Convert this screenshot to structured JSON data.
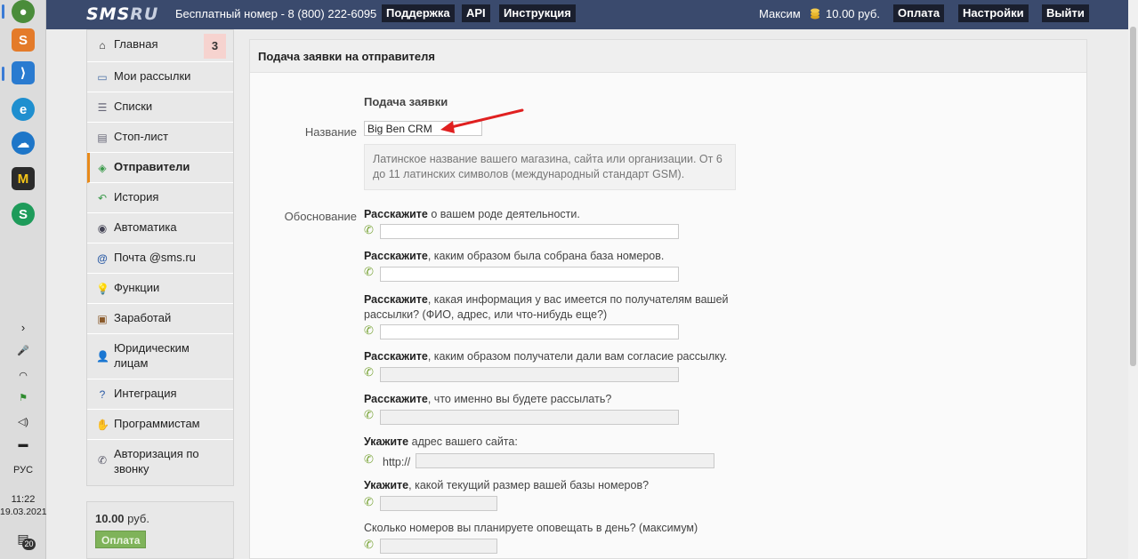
{
  "taskbar": {
    "apps": [
      {
        "name": "chrome-icon",
        "color": "#4a8c3a"
      },
      {
        "name": "sublime-icon",
        "color": "#e47b2a"
      },
      {
        "name": "vscode-icon",
        "color": "#2a7bd0"
      },
      {
        "name": "edge-icon",
        "color": "#1f8fcf"
      },
      {
        "name": "cloud-app-icon",
        "color": "#1e76c8"
      },
      {
        "name": "m-app-icon",
        "color": "#2b2b2b"
      },
      {
        "name": "s-app-icon",
        "color": "#1e9b5a"
      }
    ],
    "lang": "РУС",
    "time": "11:22",
    "date": "19.03.2021",
    "notifications": "20"
  },
  "header": {
    "logo_main": "SMS",
    "logo_suffix": "RU",
    "free_number": "Бесплатный номер - 8 (800) 222-6095",
    "support": "Поддержка",
    "api": "API",
    "instructions": "Инструкция",
    "user": "Максим",
    "balance": "10.00 руб.",
    "pay": "Оплата",
    "settings": "Настройки",
    "logout": "Выйти"
  },
  "sidebar": {
    "items": [
      {
        "label": "Главная",
        "icon": "home-icon",
        "badge": "3"
      },
      {
        "label": "Мои рассылки",
        "icon": "mailings-icon"
      },
      {
        "label": "Списки",
        "icon": "lists-icon"
      },
      {
        "label": "Стоп-лист",
        "icon": "stoplist-icon"
      },
      {
        "label": "Отправители",
        "icon": "tag-icon",
        "active": true
      },
      {
        "label": "История",
        "icon": "history-icon"
      },
      {
        "label": "Автоматика",
        "icon": "automation-icon"
      },
      {
        "label": "Почта @sms.ru",
        "icon": "at-icon"
      },
      {
        "label": "Функции",
        "icon": "bulb-icon"
      },
      {
        "label": "Заработай",
        "icon": "earn-icon"
      },
      {
        "label": "Юридическим лицам",
        "icon": "person-icon"
      },
      {
        "label": "Интеграция",
        "icon": "help-icon"
      },
      {
        "label": "Программистам",
        "icon": "hand-icon"
      },
      {
        "label": "Авторизация по звонку",
        "icon": "phone-icon"
      }
    ],
    "balance_amount": "10.00",
    "balance_unit": "руб.",
    "pay_button": "Оплата"
  },
  "form": {
    "panel_title": "Подача заявки на отправителя",
    "section_title": "Подача заявки",
    "name_label": "Название",
    "name_value": "Big Ben CRM",
    "hint": "Латинское название вашего магазина, сайта или организации. От 6 до 11 латинских символов (международный стандарт GSM).",
    "reason_label": "Обоснование",
    "questions": [
      {
        "bold": "Расскажите",
        "text": " о вашем роде деятельности."
      },
      {
        "bold": "Расскажите",
        "text": ", каким образом была собрана база номеров."
      },
      {
        "bold": "Расскажите",
        "text": ", какая информация у вас имеется по получателям вашей рассылки? (ФИО, адрес, или что-нибудь еще?)"
      },
      {
        "bold": "Расскажите",
        "text": ", каким образом получатели дали вам согласие рассылку."
      },
      {
        "bold": "Расскажите",
        "text": ", что именно вы будете рассылать?"
      },
      {
        "bold": "Укажите",
        "text": " адрес вашего сайта:"
      },
      {
        "bold": "Укажите",
        "text": ", какой текущий размер вашей базы номеров?"
      },
      {
        "bold": "",
        "text": "Сколько номеров вы планируете оповещать в день? (максимум)"
      }
    ],
    "http_prefix": "http://"
  },
  "colors": {
    "header_bg": "#3a4a6d",
    "active_accent": "#e88a1a",
    "arrow": "#e02020",
    "pay_green": "#7fb35a"
  }
}
